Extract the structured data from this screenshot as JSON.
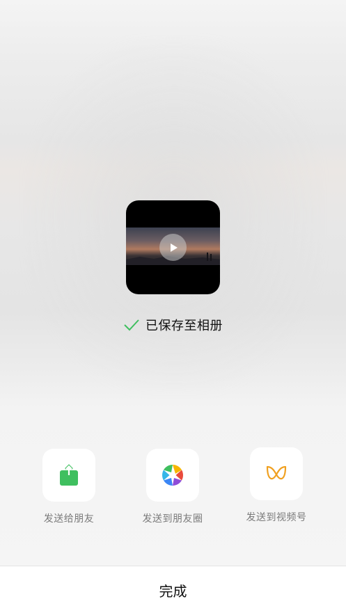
{
  "preview": {
    "play_icon": "play-icon"
  },
  "status": {
    "check_icon": "check-icon",
    "check_color": "#3fbf5f",
    "text": "已保存至相册"
  },
  "share_options": [
    {
      "label": "发送给朋友",
      "icon": "share-to-friend-icon",
      "color": "#3fbf5f"
    },
    {
      "label": "发送到朋友圈",
      "icon": "moments-icon",
      "color": "#f0a020"
    },
    {
      "label": "发送到视频号",
      "icon": "channels-icon",
      "color": "#f0a020"
    }
  ],
  "footer": {
    "done_label": "完成"
  }
}
